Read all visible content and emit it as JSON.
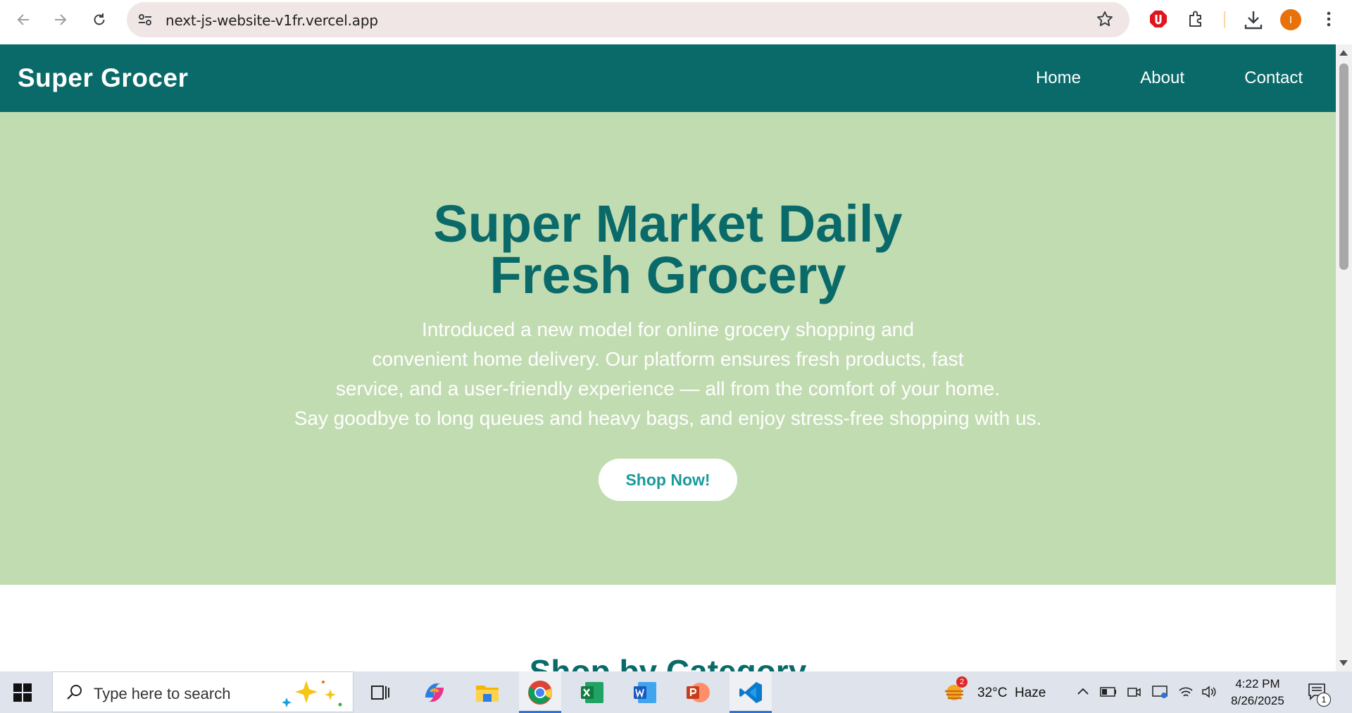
{
  "browser": {
    "url": "next-js-website-v1fr.vercel.app",
    "profile_initial": "I",
    "icons": [
      "back-arrow-icon",
      "forward-arrow-icon",
      "reload-icon",
      "site-settings-icon",
      "bookmark-star-icon",
      "adblock-extension-icon",
      "extensions-puzzle-icon",
      "downloads-icon",
      "menu-dots-icon"
    ]
  },
  "site": {
    "brand": "Super Grocer",
    "nav": [
      "Home",
      "About",
      "Contact"
    ],
    "hero": {
      "title_line1": "Super Market Daily",
      "title_line2": "Fresh Grocery",
      "desc_lines": [
        "Introduced a new model for online grocery shopping and",
        "convenient home delivery. Our platform ensures fresh products, fast",
        "service, and a user-friendly experience — all from the comfort of your home.",
        "Say goodbye to long queues and heavy bags, and enjoy stress-free shopping with us."
      ],
      "cta": "Shop Now!"
    },
    "section_title": "Shop by Category",
    "colors": {
      "header_bg": "#0a6a6a",
      "hero_bg": "#c2dcb2",
      "title_color": "#0a6a6a",
      "cta_text": "#1a9a9a"
    }
  },
  "taskbar": {
    "search_placeholder": "Type here to search",
    "apps": [
      "task-view-icon",
      "copilot-icon",
      "file-explorer-icon",
      "chrome-icon",
      "excel-icon",
      "word-icon",
      "powerpoint-icon",
      "vscode-icon"
    ],
    "weather": "32°C  Haze",
    "weather_badge": "2",
    "time": "4:22 PM",
    "date": "8/26/2025",
    "notification_count": "1"
  }
}
